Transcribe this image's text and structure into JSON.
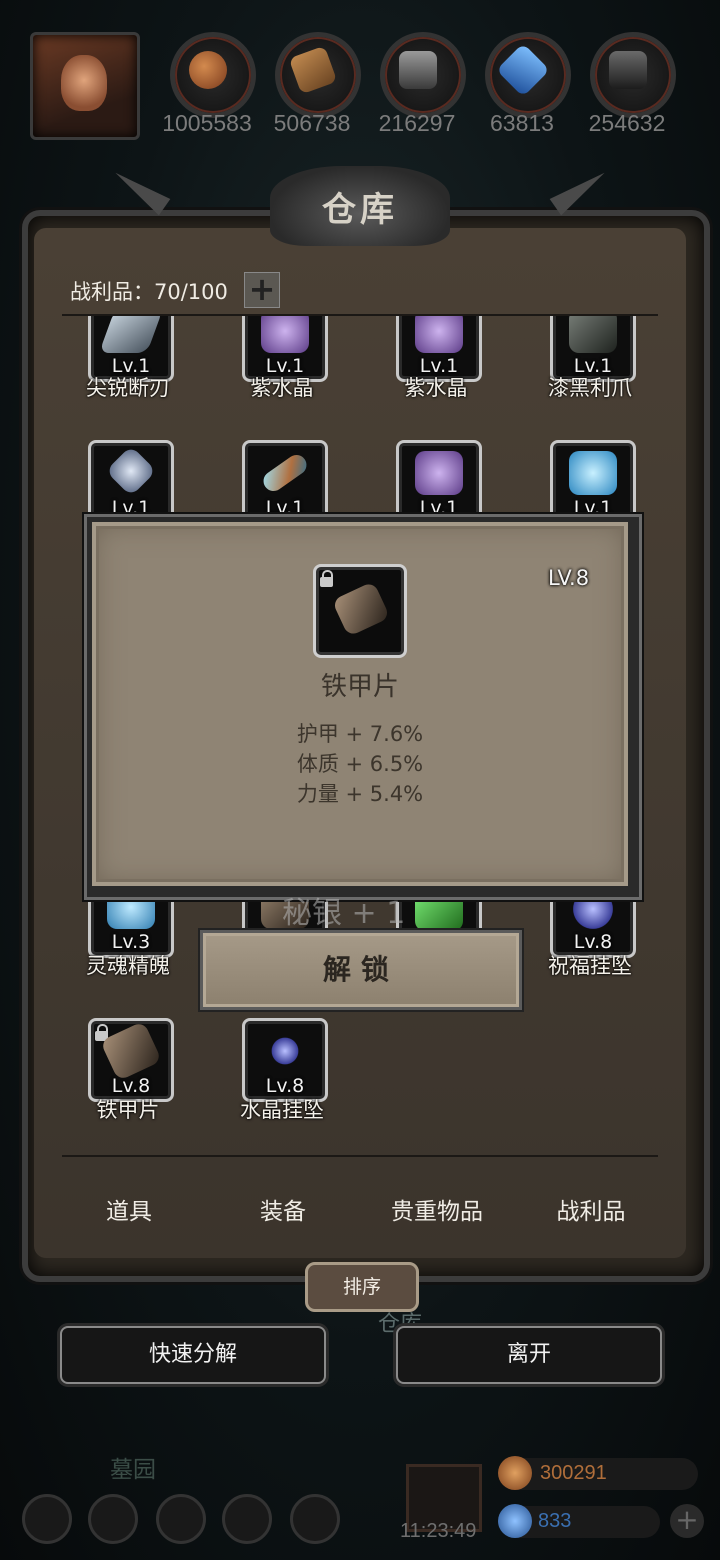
{
  "resources": [
    {
      "icon": "meat-icon",
      "value": "1005583",
      "color": "#b86a3a"
    },
    {
      "icon": "wood-icon",
      "value": "506738",
      "color": "#a0703e"
    },
    {
      "icon": "stone-icon",
      "value": "216297",
      "color": "#7a7a7a"
    },
    {
      "icon": "crystal-icon",
      "value": "63813",
      "color": "#3f7fd0"
    },
    {
      "icon": "iron-icon",
      "value": "254632",
      "color": "#555555"
    }
  ],
  "panel": {
    "title": "仓库",
    "loot_label": "战利品：70/100",
    "plus": "+"
  },
  "items": [
    {
      "level": "Lv.1",
      "name": "尖锐断刃",
      "icon": "blade-icon",
      "color": "#8fa0b0"
    },
    {
      "level": "Lv.1",
      "name": "紫水晶",
      "icon": "amethyst-icon",
      "color": "#9b7ac0"
    },
    {
      "level": "Lv.1",
      "name": "紫水晶",
      "icon": "amethyst-icon",
      "color": "#9b7ac0"
    },
    {
      "level": "Lv.1",
      "name": "漆黑利爪",
      "icon": "claw-icon",
      "color": "#555a55"
    },
    {
      "level": "Lv.1",
      "name": "",
      "icon": "rune-icon",
      "color": "#b9c3d2"
    },
    {
      "level": "Lv.1",
      "name": "",
      "icon": "bone-icon",
      "color": "#4fb3cf"
    },
    {
      "level": "Lv.1",
      "name": "",
      "icon": "amethyst-icon",
      "color": "#9b7ac0"
    },
    {
      "level": "Lv.1",
      "name": "",
      "icon": "ice-crystal-icon",
      "color": "#6ec0e8"
    },
    {
      "level": "Lv.3",
      "name": "灵魂精魄",
      "icon": "soul-icon",
      "color": "#5fb0d8"
    },
    {
      "level": "Lv.8",
      "name": "祝福挂坠",
      "icon": "pendant-icon",
      "color": "#6c7ad0"
    },
    {
      "level": "Lv.8",
      "name": "铁甲片",
      "icon": "armor-shard-icon",
      "color": "#6b5a48"
    },
    {
      "level": "Lv.8",
      "name": "水晶挂坠",
      "icon": "pendant-icon",
      "color": "#6c7ad0"
    }
  ],
  "tabs": [
    "道具",
    "装备",
    "贵重物品",
    "战利品"
  ],
  "popup": {
    "level": "LV.8",
    "name": "铁甲片",
    "stats": [
      "护甲 + 7.6%",
      "体质 + 6.5%",
      "力量 + 5.4%"
    ],
    "unlock_label": "解锁",
    "behind_text": "秘银 + 1"
  },
  "buttons": {
    "sort": "排序",
    "quick_decompose": "快速分解",
    "leave": "离开",
    "under_text": "仓库"
  },
  "hud": {
    "location": "墓园",
    "time": "11:23:49",
    "gold": "300291",
    "gems": "833",
    "gold_color": "#b06e3a",
    "gem_color": "#3a6fb0"
  }
}
